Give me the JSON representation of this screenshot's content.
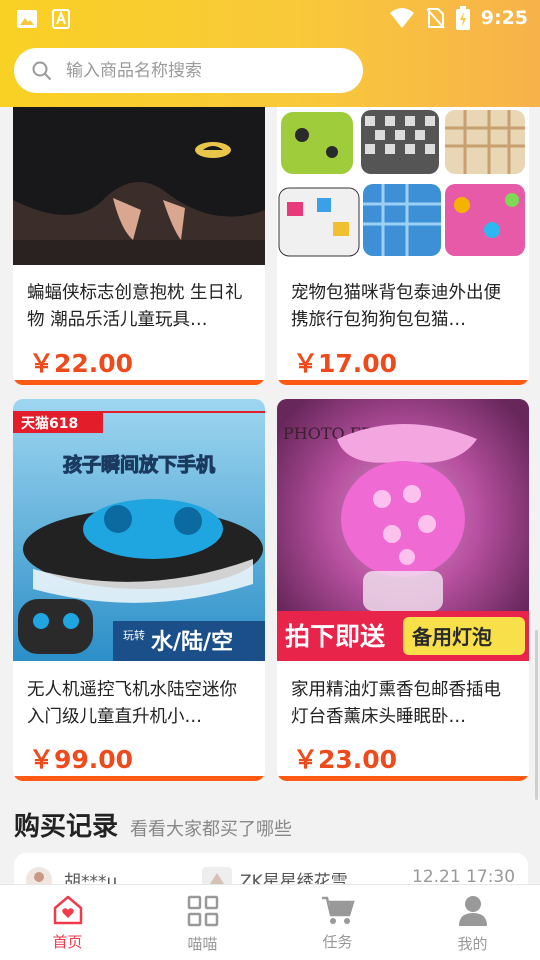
{
  "status_bar": {
    "time": "9:25"
  },
  "search": {
    "placeholder": "输入商品名称搜索"
  },
  "products": [
    {
      "title": "蝙蝠侠标志创意抱枕 生日礼物 潮品乐活儿童玩具…",
      "price": "￥22.00"
    },
    {
      "title": "宠物包猫咪背包泰迪外出便携旅行包狗狗包包猫…",
      "price": "￥17.00"
    },
    {
      "title": "无人机遥控飞机水陆空迷你入门级儿童直升机小…",
      "price": "￥99.00",
      "image_text": {
        "tag": "天猫618",
        "headline": "孩子瞬间放下手机",
        "badge_small": "玩转",
        "badge": "水/陆/空"
      }
    },
    {
      "title": "家用精油灯熏香包邮香插电灯台香薰床头睡眠卧…",
      "price": "￥23.00",
      "image_text": {
        "frame_text": "PHOTO FRAME",
        "banner": "拍下即送",
        "banner2": "备用灯泡"
      }
    }
  ],
  "section": {
    "title": "购买记录",
    "subtitle": "看看大家都买了哪些"
  },
  "record": {
    "user": "胡***u",
    "product": "ZK星星绣花雪…",
    "time": "12.21 17:30"
  },
  "tabs": [
    {
      "label": "首页",
      "icon": "home-heart-icon",
      "active": true
    },
    {
      "label": "喵喵",
      "icon": "grid-icon",
      "active": false
    },
    {
      "label": "任务",
      "icon": "cart-icon",
      "active": false
    },
    {
      "label": "我的",
      "icon": "person-icon",
      "active": false
    }
  ],
  "colors": {
    "header_start": "#f9d024",
    "header_end": "#f7b24a",
    "price": "#ef4a1c",
    "accent_bar": "#ff5a14",
    "active_tab": "#ef3b4c"
  }
}
